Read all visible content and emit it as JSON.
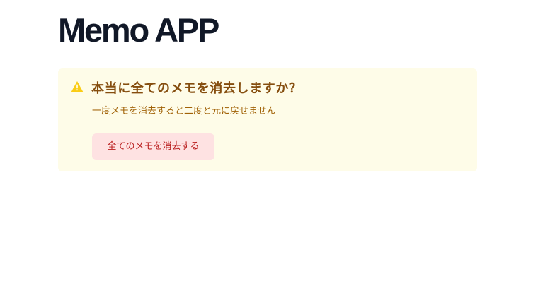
{
  "app": {
    "title": "Memo APP"
  },
  "alert": {
    "icon": "warning-triangle-icon",
    "heading": "本当に全てのメモを消去しますか？",
    "description": "一度メモを消去すると二度と元に戻せません",
    "delete_all_button_label": "全てのメモを消去する",
    "colors": {
      "background": "#fefce8",
      "icon": "#facc15",
      "heading": "#854d0e",
      "description": "#a16207",
      "button_background": "#fee2e2",
      "button_text": "#b91c1c"
    }
  }
}
